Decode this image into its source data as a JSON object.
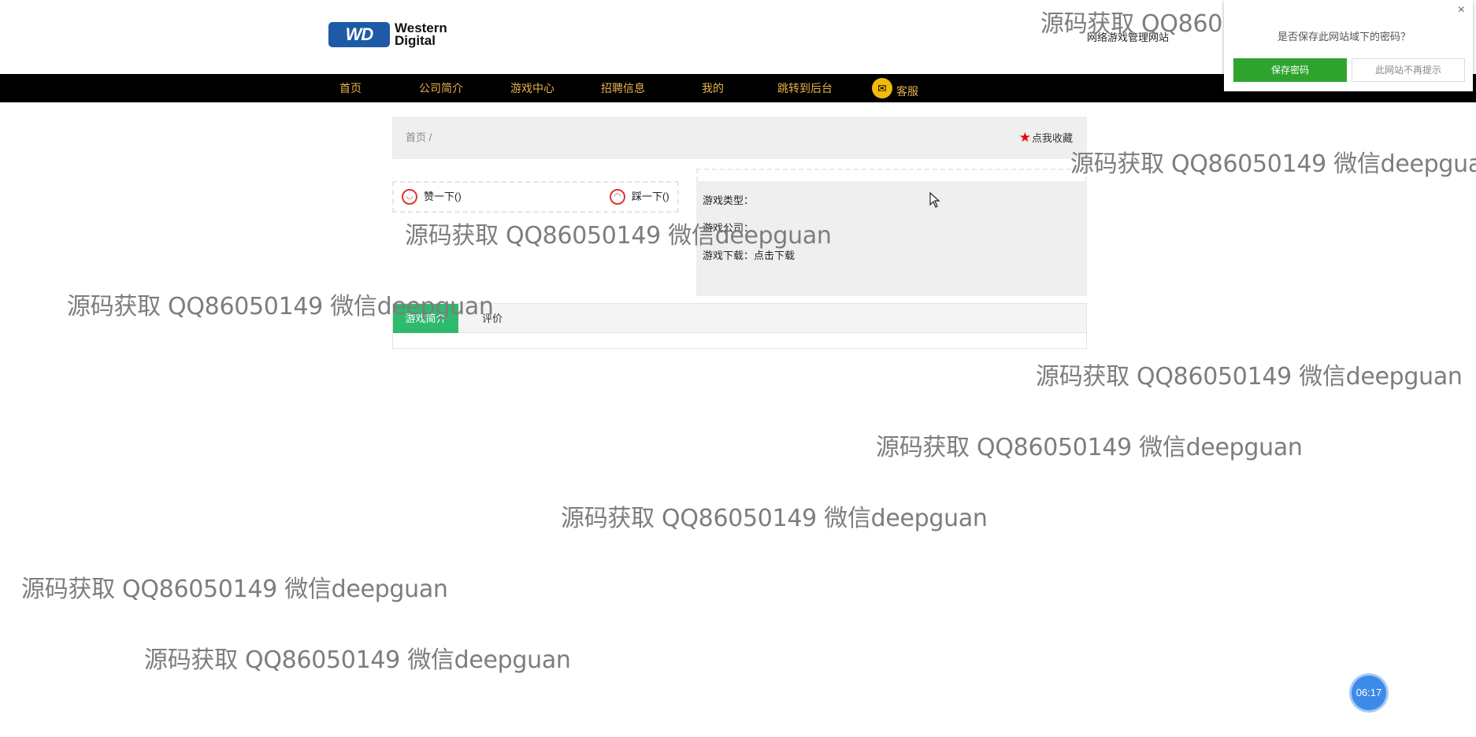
{
  "header": {
    "logo": {
      "badge": "WD",
      "line1": "Western",
      "line2": "Digital"
    },
    "site_subtitle": "网络游戏管理网站"
  },
  "nav": {
    "items": [
      "首页",
      "公司简介",
      "游戏中心",
      "招聘信息",
      "我的",
      "跳转到后台"
    ],
    "kefu_label": "客服",
    "color": "#e8b24a"
  },
  "breadcrumb": {
    "text": "首页  /",
    "favorite_label": "点我收藏"
  },
  "vote": {
    "like_label": "赞一下()",
    "dislike_label": "踩一下()"
  },
  "game_info": {
    "type_label": "游戏类型：",
    "company_label": "游戏公司：",
    "download_label": "游戏下载：点击下载"
  },
  "tabs": {
    "items": [
      "游戏简介",
      "评价"
    ],
    "active_color": "#2fba6e"
  },
  "password_prompt": {
    "question": "是否保存此网站域下的密码？",
    "save_label": "保存密码",
    "never_label": "此网站不再提示",
    "close_glyph": "×"
  },
  "watermark": "源码获取 QQ86050149 微信deepguan",
  "timer": "06:17"
}
